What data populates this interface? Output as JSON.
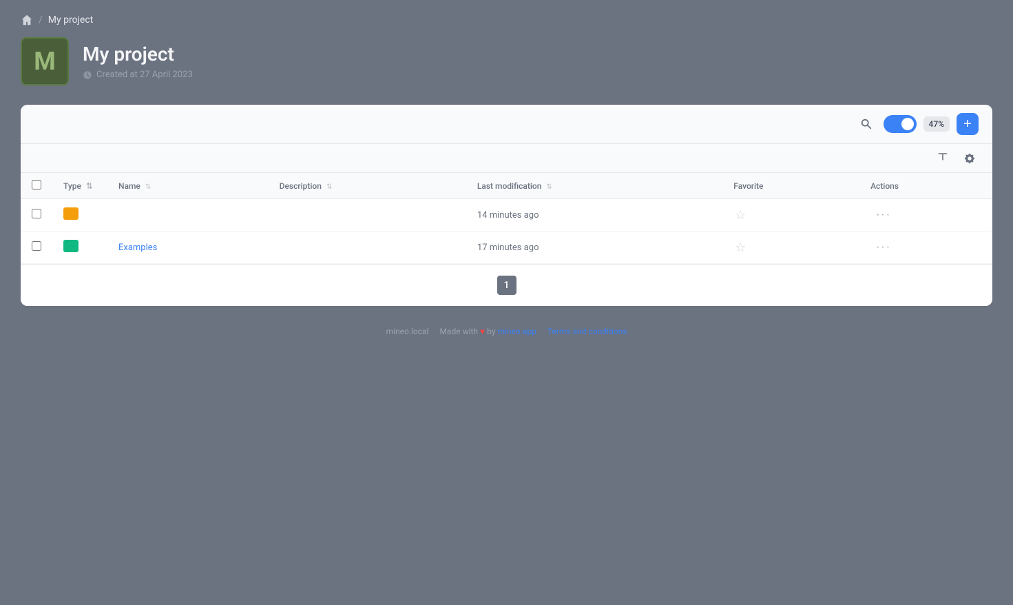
{
  "breadcrumb": {
    "home_label": "Home",
    "separator": "/",
    "current": "My project"
  },
  "project": {
    "avatar_letter": "M",
    "title": "My project",
    "created_label": "Created at 27 April 2023"
  },
  "toolbar": {
    "zoom_level": "47%",
    "add_label": "+"
  },
  "table": {
    "columns": [
      {
        "key": "checkbox",
        "label": ""
      },
      {
        "key": "type",
        "label": "Type",
        "sortable": true
      },
      {
        "key": "name",
        "label": "Name",
        "sortable": true
      },
      {
        "key": "description",
        "label": "Description",
        "sortable": true
      },
      {
        "key": "last_modification",
        "label": "Last modification",
        "sortable": true
      },
      {
        "key": "favorite",
        "label": "Favorite"
      },
      {
        "key": "actions",
        "label": "Actions"
      }
    ],
    "rows": [
      {
        "id": 1,
        "type": "folder-orange",
        "name": "",
        "description": "",
        "last_modification": "14 minutes ago",
        "favorite": false
      },
      {
        "id": 2,
        "type": "folder-green",
        "name": "Examples",
        "description": "",
        "last_modification": "17 minutes ago",
        "favorite": false
      }
    ]
  },
  "pagination": {
    "current_page": "1"
  },
  "footer": {
    "app_name": "mineo.local",
    "made_with": "Made with",
    "by": "by",
    "brand_link": "mineo.app",
    "terms_link": "Terms and conditions"
  }
}
